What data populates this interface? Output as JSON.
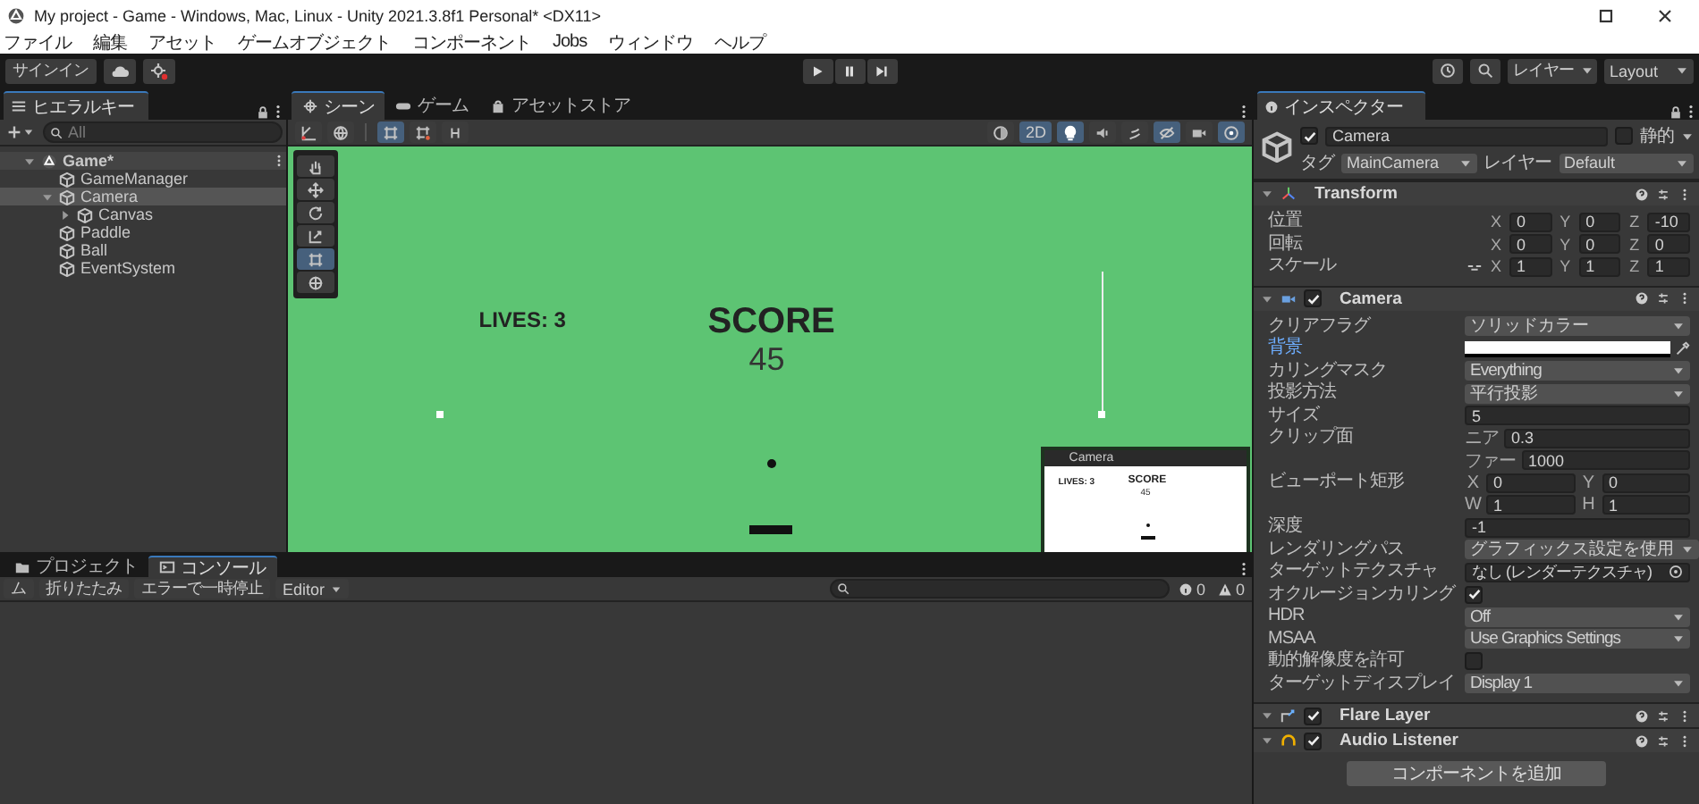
{
  "window": {
    "title": "My project - Game - Windows, Mac, Linux - Unity 2021.3.8f1 Personal* <DX11>"
  },
  "menu": [
    "ファイル",
    "編集",
    "アセット",
    "ゲームオブジェクト",
    "コンポーネント",
    "Jobs",
    "ウィンドウ",
    "ヘルプ"
  ],
  "toolbar": {
    "sign_in": "サインイン",
    "layers": "レイヤー",
    "layout": "Layout"
  },
  "hierarchy": {
    "tab": "ヒエラルキー",
    "search_placeholder": "All",
    "items": [
      {
        "label": "Game*",
        "kind": "scene",
        "expanded": true,
        "selected": false,
        "children": [
          {
            "label": "GameManager",
            "kind": "object",
            "selected": false
          },
          {
            "label": "Camera",
            "kind": "object",
            "expanded": true,
            "selected": true,
            "children": [
              {
                "label": "Canvas",
                "kind": "object",
                "expanded": false,
                "selected": false
              }
            ]
          },
          {
            "label": "Paddle",
            "kind": "object",
            "selected": false
          },
          {
            "label": "Ball",
            "kind": "object",
            "selected": false
          },
          {
            "label": "EventSystem",
            "kind": "object",
            "selected": false
          }
        ]
      }
    ]
  },
  "scene_tabs": [
    {
      "label": "シーン",
      "kind": "scene",
      "selected": true
    },
    {
      "label": "ゲーム",
      "kind": "game",
      "selected": false
    },
    {
      "label": "アセットストア",
      "kind": "store",
      "selected": false
    }
  ],
  "scene_toolbar_left": [
    {
      "kind": "grid",
      "on": false
    },
    {
      "kind": "globe",
      "on": false
    },
    {
      "kind": "rect",
      "on": true
    },
    {
      "kind": "snap",
      "on": false
    },
    {
      "kind": "increment",
      "on": false
    }
  ],
  "scene_toolbar_right": [
    {
      "kind": "shading",
      "on": false
    },
    {
      "kind": "mode",
      "label": "2D",
      "on": true
    },
    {
      "kind": "lighting",
      "on": true
    },
    {
      "kind": "audio",
      "on": false
    },
    {
      "kind": "effects",
      "on": false
    },
    {
      "kind": "visibility",
      "on": true
    },
    {
      "kind": "camera",
      "on": false
    },
    {
      "kind": "gizmos",
      "on": true
    }
  ],
  "tools": [
    {
      "kind": "hand",
      "selected": false
    },
    {
      "kind": "move",
      "selected": false
    },
    {
      "kind": "rotate",
      "selected": false
    },
    {
      "kind": "scale",
      "selected": false
    },
    {
      "kind": "rect",
      "selected": true
    },
    {
      "kind": "transform",
      "selected": false
    }
  ],
  "scene": {
    "lives": "LIVES: 3",
    "score_label": "SCORE",
    "score": "45",
    "preview": {
      "title": "Camera",
      "lives": "LIVES: 3",
      "score_label": "SCORE",
      "score": "45"
    }
  },
  "bottom_tabs": [
    {
      "label": "プロジェクト",
      "kind": "project",
      "selected": false
    },
    {
      "label": "コンソール",
      "kind": "console",
      "selected": true
    }
  ],
  "console": {
    "buttons": [
      "ム",
      "折りたたみ",
      "エラーで一時停止"
    ],
    "target": "Editor",
    "counters": [
      {
        "kind": "info",
        "count": "0"
      },
      {
        "kind": "warning",
        "count": "0"
      }
    ]
  },
  "inspector": {
    "tab": "インスペクター",
    "object": {
      "name": "Camera",
      "active": true,
      "static_label": "静的",
      "static": false,
      "tag_label": "タグ",
      "tag": "MainCamera",
      "layer_label": "レイヤー",
      "layer": "Default"
    },
    "transform": {
      "title": "Transform",
      "rows": [
        {
          "label": "位置",
          "constrain": false,
          "values": [
            {
              "axis": "X",
              "value": "0"
            },
            {
              "axis": "Y",
              "value": "0"
            },
            {
              "axis": "Z",
              "value": "-10"
            }
          ]
        },
        {
          "label": "回転",
          "constrain": false,
          "values": [
            {
              "axis": "X",
              "value": "0"
            },
            {
              "axis": "Y",
              "value": "0"
            },
            {
              "axis": "Z",
              "value": "0"
            }
          ]
        },
        {
          "label": "スケール",
          "constrain": true,
          "values": [
            {
              "axis": "X",
              "value": "1"
            },
            {
              "axis": "Y",
              "value": "1"
            },
            {
              "axis": "Z",
              "value": "1"
            }
          ]
        }
      ]
    },
    "camera": {
      "title": "Camera",
      "enabled": true,
      "rows": [
        {
          "kind": "dropdown",
          "label": "クリアフラグ",
          "highlighted": false,
          "value": "ソリッドカラー"
        },
        {
          "kind": "color",
          "label": "背景",
          "highlighted": true,
          "color": "#ffffff"
        },
        {
          "kind": "dropdown",
          "label": "カリングマスク",
          "highlighted": false,
          "value": "Everything"
        },
        {
          "kind": "dropdown",
          "label": "投影方法",
          "highlighted": false,
          "value": "平行投影"
        },
        {
          "kind": "field",
          "label": "サイズ",
          "highlighted": false,
          "value": "5"
        },
        {
          "kind": "pairs",
          "label": "クリップ面",
          "highlighted": false,
          "lines": [
            [
              {
                "axis": "ニア",
                "value": "0.3"
              }
            ],
            [
              {
                "axis": "ファー",
                "value": "1000"
              }
            ]
          ]
        },
        {
          "kind": "pairs",
          "label": "ビューポート矩形",
          "highlighted": false,
          "lines": [
            [
              {
                "axis": "X",
                "value": "0"
              },
              {
                "axis": "Y",
                "value": "0"
              }
            ],
            [
              {
                "axis": "W",
                "value": "1"
              },
              {
                "axis": "H",
                "value": "1"
              }
            ]
          ]
        },
        {
          "kind": "field",
          "label": "深度",
          "highlighted": false,
          "value": "-1"
        },
        {
          "kind": "dropdown",
          "label": "レンダリングパス",
          "highlighted": false,
          "value": "グラフィックス設定を使用"
        },
        {
          "kind": "object",
          "label": "ターゲットテクスチャ",
          "highlighted": false,
          "value": "なし (レンダーテクスチャ)"
        },
        {
          "kind": "checkbox",
          "label": "オクルージョンカリング",
          "highlighted": false,
          "checked": true
        },
        {
          "kind": "dropdown",
          "label": "HDR",
          "highlighted": false,
          "value": "Off"
        },
        {
          "kind": "dropdown",
          "label": "MSAA",
          "highlighted": false,
          "value": "Use Graphics Settings"
        },
        {
          "kind": "checkbox",
          "label": "動的解像度を許可",
          "highlighted": false,
          "checked": false
        },
        {
          "kind": "dropdown",
          "label": "ターゲットディスプレイ",
          "highlighted": false,
          "value": "Display 1"
        }
      ]
    },
    "components": [
      {
        "title": "Flare Layer",
        "kind": "flare",
        "enabled": true
      },
      {
        "title": "Audio Listener",
        "kind": "audio",
        "enabled": true
      }
    ],
    "add_button": "コンポーネントを追加"
  }
}
